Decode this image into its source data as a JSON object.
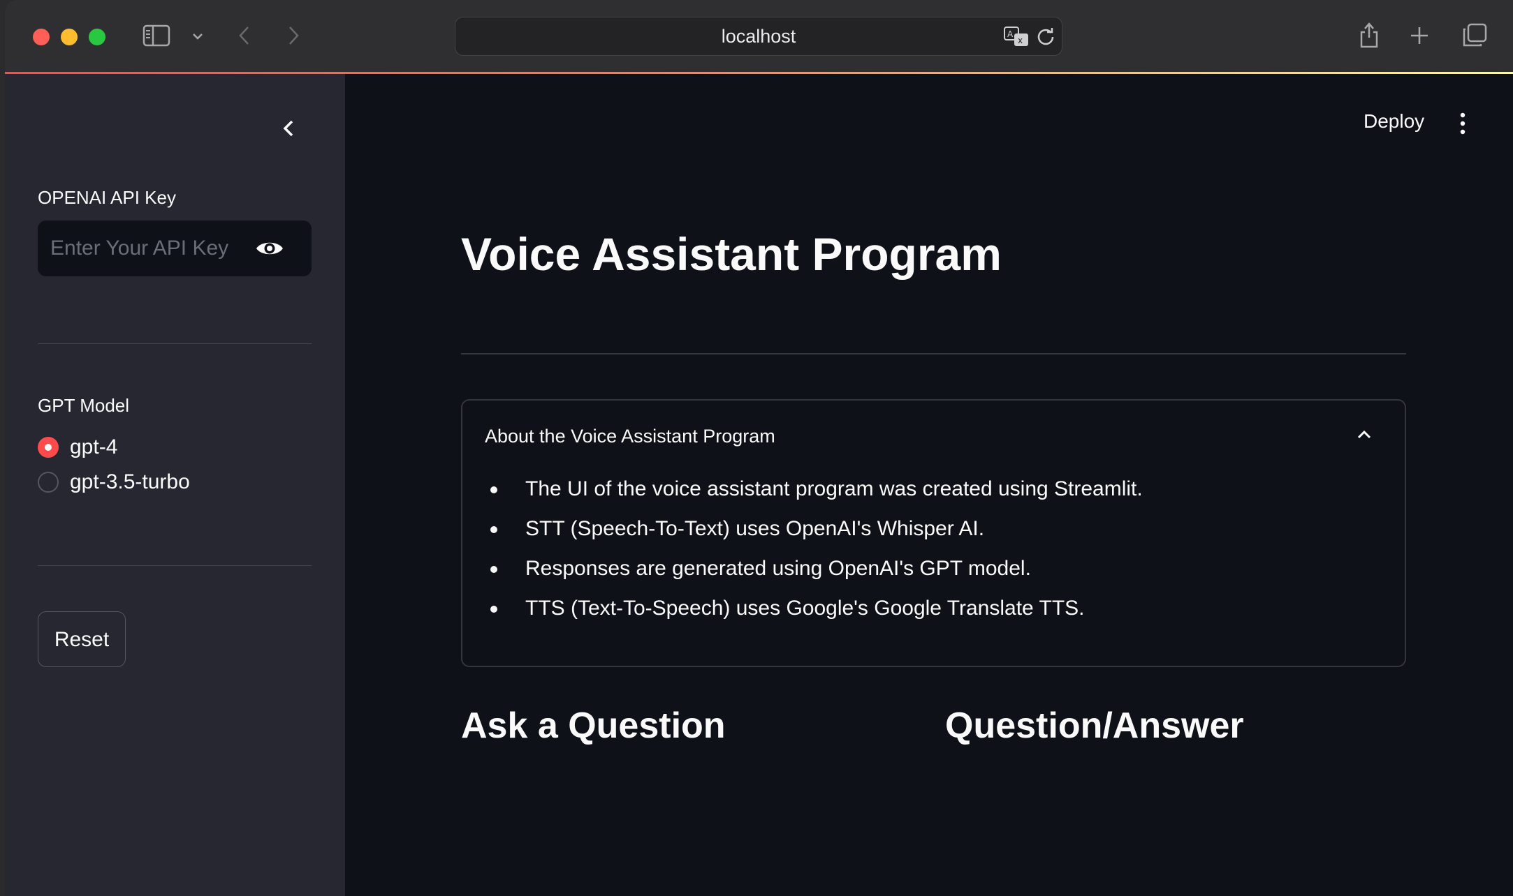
{
  "browser": {
    "url": "localhost"
  },
  "sidebar": {
    "api_key_label": "OPENAI API Key",
    "api_key_placeholder": "Enter Your API Key",
    "model_label": "GPT Model",
    "models": [
      {
        "label": "gpt-4",
        "selected": true
      },
      {
        "label": "gpt-3.5-turbo",
        "selected": false
      }
    ],
    "reset_label": "Reset"
  },
  "header": {
    "deploy_label": "Deploy"
  },
  "main": {
    "title": "Voice Assistant Program",
    "expander": {
      "title": "About the Voice Assistant Program",
      "items": [
        "The UI of the voice assistant program was created using Streamlit.",
        "STT (Speech-To-Text) uses OpenAI's Whisper AI.",
        "Responses are generated using OpenAI's GPT model.",
        "TTS (Text-To-Speech) uses Google's Google Translate TTS."
      ]
    },
    "ask_heading": "Ask a Question",
    "qa_heading": "Question/Answer"
  },
  "colors": {
    "accent": "#ff4b4b",
    "main_background": "#0e1117",
    "sidebar_background": "#262730",
    "text": "#fafafa"
  }
}
